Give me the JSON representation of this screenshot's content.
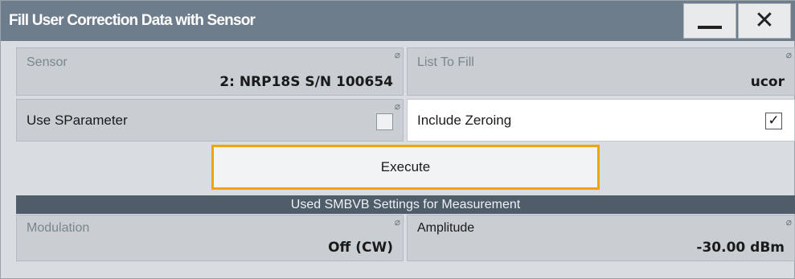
{
  "dialog": {
    "title": "Fill User Correction Data with Sensor",
    "minimize_icon": "minimize-icon",
    "close_icon": "close-icon",
    "close_glyph": "✕"
  },
  "sensor": {
    "label": "Sensor",
    "value": "2: NRP18S S/N 100654"
  },
  "list_to_fill": {
    "label": "List To Fill",
    "value": "ucor"
  },
  "use_sparameter": {
    "label": "Use SParameter",
    "checked": false
  },
  "include_zeroing": {
    "label": "Include Zeroing",
    "checked": true,
    "check_glyph": "✓"
  },
  "execute": {
    "label": "Execute"
  },
  "settings_section": {
    "title": "Used SMBVB Settings for Measurement"
  },
  "modulation": {
    "label": "Modulation",
    "value": "Off (CW)"
  },
  "amplitude": {
    "label": "Amplitude",
    "value": "-30.00 dBm"
  },
  "readonly_icon": "⌀",
  "colors": {
    "titlebar": "#6e7d8c",
    "section_bar": "#4f5d6b",
    "focus_border": "#f0a500",
    "background": "#d9dde1"
  }
}
